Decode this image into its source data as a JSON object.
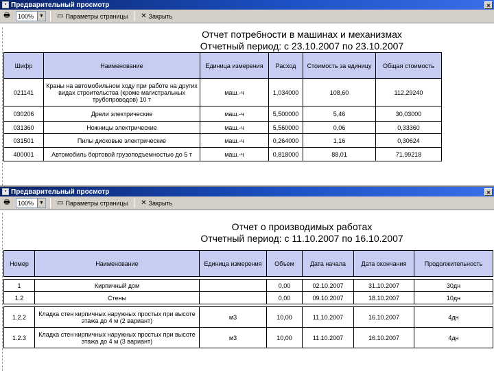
{
  "top_window": {
    "title": "Предварительный просмотр",
    "close_glyph": "×",
    "toolbar": {
      "zoom_value": "100%",
      "page_setup_label": "Параметры страницы",
      "close_label": "Закрыть"
    },
    "report": {
      "title_line1": "Отчет потребности в машинах и механизмах",
      "title_line2": "Отчетный период: с 23.10.2007 по 23.10.2007",
      "columns": [
        "Шифр",
        "Наименование",
        "Единица измерения",
        "Расход",
        "Стоимость за единицу",
        "Общая стоимость"
      ],
      "rows": [
        [
          "021141",
          "Краны на автомобильном ходу при работе на других видах строительства (кроме магистральных трубопроводов) 10 т",
          "маш.-ч",
          "1,034000",
          "108,60",
          "112,29240"
        ],
        [
          "030206",
          "Дрели электрические",
          "маш.-ч",
          "5,500000",
          "5,46",
          "30,03000"
        ],
        [
          "031360",
          "Ножницы электрические",
          "маш.-ч",
          "5,560000",
          "0,06",
          "0,33360"
        ],
        [
          "031501",
          "Пилы дисковые электрические",
          "маш.-ч",
          "0,264000",
          "1,16",
          "0,30624"
        ],
        [
          "400001",
          "Автомобиль бортовой грузоподъемностью до 5 т",
          "маш.-ч",
          "0,818000",
          "88,01",
          "71,99218"
        ]
      ]
    }
  },
  "bottom_window": {
    "title": "Предварительный просмотр",
    "close_glyph": "×",
    "toolbar": {
      "zoom_value": "100%",
      "page_setup_label": "Параметры страницы",
      "close_label": "Закрыть"
    },
    "report": {
      "title_line1": "Отчет о производимых работах",
      "title_line2": "Отчетный период: с 11.10.2007 по 16.10.2007",
      "columns": [
        "Номер",
        "Наименование",
        "Единица измерения",
        "Объем",
        "Дата начала",
        "Дата окончания",
        "Продолжительность"
      ],
      "rows": [
        [
          "1",
          "Кирпичный дом",
          "",
          "0,00",
          "02.10.2007",
          "31.10.2007",
          "30дн"
        ],
        [
          "1.2",
          "Стены",
          "",
          "0,00",
          "09.10.2007",
          "18.10.2007",
          "10дн"
        ],
        [
          "1.2.2",
          "Кладка стен кирпичных наружных простых при высоте этажа до 4 м (2 вариант)",
          "м3",
          "10,00",
          "11.10.2007",
          "16.10.2007",
          "4дн"
        ],
        [
          "1.2.3",
          "Кладка стен кирпичных наружных простых при высоте этажа до 4 м (3 вариант)",
          "м3",
          "10,00",
          "11.10.2007",
          "16.10.2007",
          "4дн"
        ]
      ]
    }
  }
}
